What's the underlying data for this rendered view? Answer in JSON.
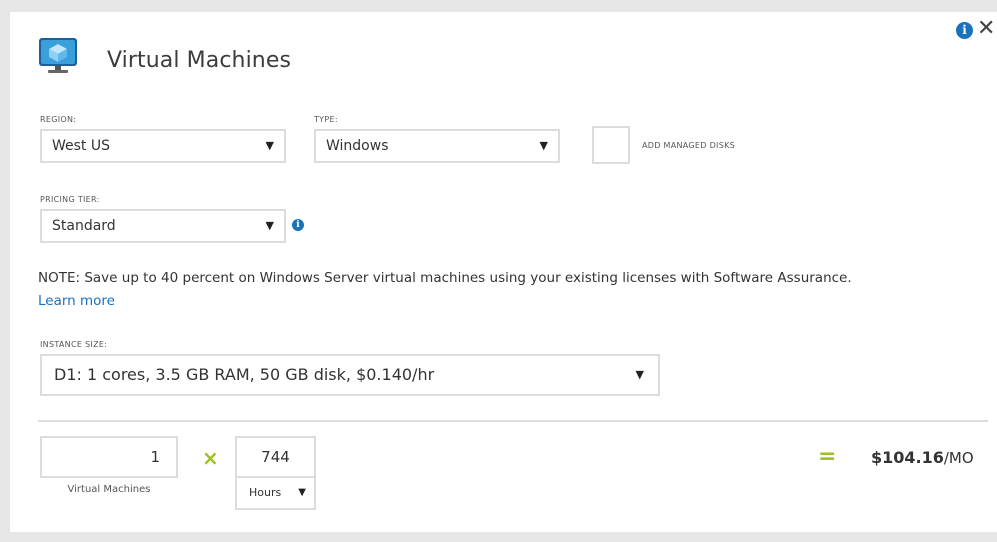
{
  "header": {
    "title": "Virtual Machines",
    "icon": "virtual-machine-icon",
    "info_icon": "info-icon",
    "close_glyph": "✕"
  },
  "region": {
    "label": "REGION:",
    "value": "West US"
  },
  "type": {
    "label": "TYPE:",
    "value": "Windows"
  },
  "managed_disks": {
    "label": "ADD MANAGED DISKS",
    "checked": false
  },
  "pricing_tier": {
    "label": "PRICING TIER:",
    "value": "Standard"
  },
  "note": {
    "text": "NOTE: Save up to 40 percent on Windows Server virtual machines using your existing licenses with Software Assurance.",
    "link": "Learn more"
  },
  "instance_size": {
    "label": "INSTANCE SIZE:",
    "value": "D1: 1 cores, 3.5 GB RAM, 50 GB disk, $0.140/hr"
  },
  "calc": {
    "vm_count": "1",
    "vm_caption": "Virtual Machines",
    "times": "×",
    "hours": "744",
    "hours_unit": "Hours",
    "equals": "=",
    "total": "$104.16",
    "total_unit": "/MO"
  },
  "colors": {
    "accent_green": "#9bc31c",
    "info_blue": "#1a72bb",
    "border": "#dcdcdc"
  }
}
